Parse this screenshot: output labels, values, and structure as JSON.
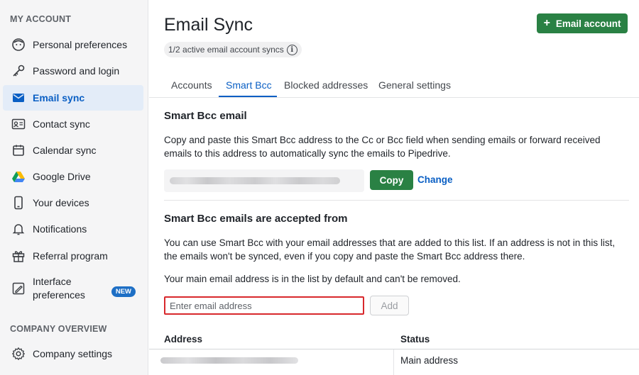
{
  "sidebar": {
    "section_account": "MY ACCOUNT",
    "items": [
      {
        "label": "Personal preferences",
        "icon": "face-icon"
      },
      {
        "label": "Password and login",
        "icon": "key-icon"
      },
      {
        "label": "Email sync",
        "icon": "mail-icon",
        "active": true
      },
      {
        "label": "Contact sync",
        "icon": "contact-card-icon"
      },
      {
        "label": "Calendar sync",
        "icon": "calendar-icon"
      },
      {
        "label": "Google Drive",
        "icon": "google-drive-icon"
      },
      {
        "label": "Your devices",
        "icon": "phone-icon"
      },
      {
        "label": "Notifications",
        "icon": "bell-icon"
      },
      {
        "label": "Referral program",
        "icon": "gift-icon"
      },
      {
        "label": "Interface preferences",
        "icon": "interface-edit-icon",
        "badge": "NEW"
      }
    ],
    "section_company": "COMPANY OVERVIEW",
    "company_items": [
      {
        "label": "Company settings",
        "icon": "gear-icon"
      }
    ]
  },
  "header": {
    "title": "Email Sync",
    "add_button": "Email account",
    "sync_status": "1/2 active email account syncs"
  },
  "tabs": [
    {
      "label": "Accounts"
    },
    {
      "label": "Smart Bcc",
      "active": true
    },
    {
      "label": "Blocked addresses"
    },
    {
      "label": "General settings"
    }
  ],
  "smart_bcc": {
    "heading": "Smart Bcc email",
    "description": "Copy and paste this Smart Bcc address to the Cc or Bcc field when sending emails or forward received emails to this address to automatically sync the emails to Pipedrive.",
    "copy_button": "Copy",
    "change_link": "Change"
  },
  "accepted": {
    "heading": "Smart Bcc emails are accepted from",
    "description": "You can use Smart Bcc with your email addresses that are added to this list. If an address is not in this list, the emails won't be synced, even if you copy and paste the Smart Bcc address there.",
    "note": "Your main email address is in the list by default and can't be removed.",
    "input_placeholder": "Enter email address",
    "add_button": "Add"
  },
  "table": {
    "headers": [
      "Address",
      "Status"
    ],
    "rows": [
      {
        "status": "Main address"
      }
    ]
  },
  "colors": {
    "accent_green": "#2a8144",
    "link_blue": "#0a5fc4",
    "active_bg": "#e3ecf8",
    "input_error_border": "#d8282c"
  }
}
